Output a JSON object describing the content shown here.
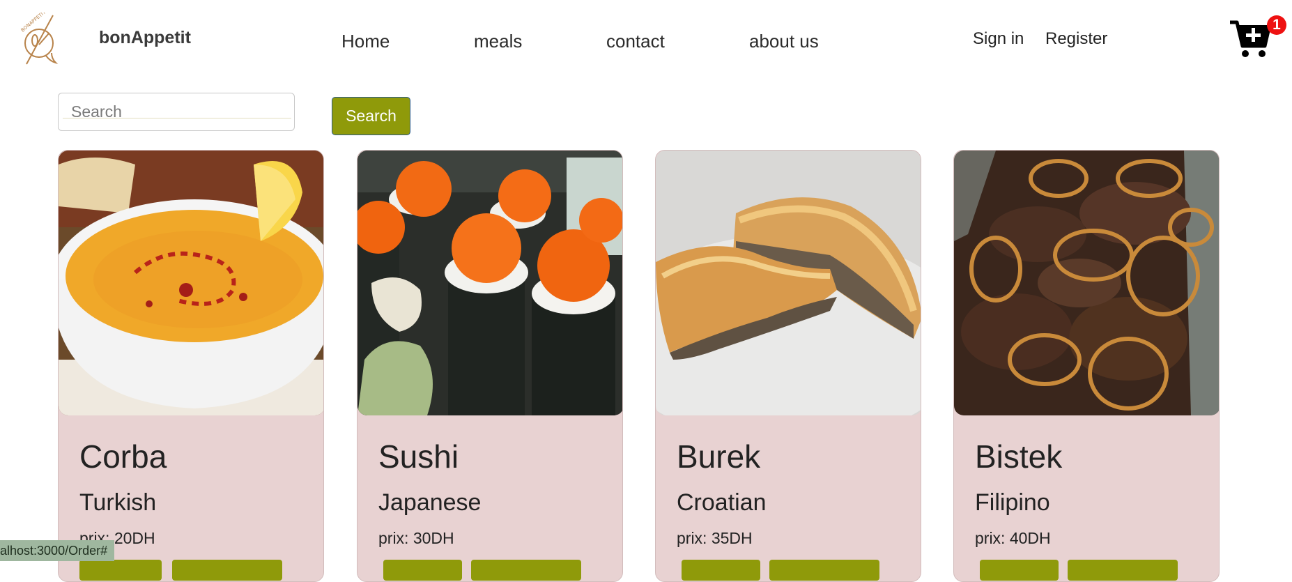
{
  "brand": {
    "name": "bonAppetit",
    "logo_text": "BONAPPETIT"
  },
  "nav": {
    "items": [
      "Home",
      "meals",
      "contact",
      "about us"
    ]
  },
  "auth": {
    "sign_in": "Sign in",
    "register": "Register"
  },
  "cart": {
    "count": "1",
    "icon": "cart-plus-icon"
  },
  "search": {
    "placeholder": "Search",
    "value": "",
    "button_label": "Search"
  },
  "meals": [
    {
      "name": "Corba",
      "cuisine": "Turkish",
      "price": "prix: 20DH",
      "image": "lentil soup with lemon"
    },
    {
      "name": "Sushi",
      "cuisine": "Japanese",
      "price": "prix: 30DH",
      "image": "sushi rolls with tobiko"
    },
    {
      "name": "Burek",
      "cuisine": "Croatian",
      "price": "prix: 35DH",
      "image": "meat burek pastry"
    },
    {
      "name": "Bistek",
      "cuisine": "Filipino",
      "price": "prix: 40DH",
      "image": "beef with onion rings"
    }
  ],
  "status_bar": {
    "url": "alhost:3000/Order#"
  },
  "colors": {
    "accent": "#8f9a0a",
    "card_bg": "#e8d2d2",
    "badge": "#ee1111",
    "logo": "#b8834a"
  }
}
